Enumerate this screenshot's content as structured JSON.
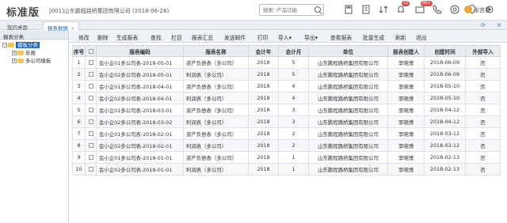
{
  "app": {
    "logo": "标准版",
    "company": "[001]山东鹏程路桥集团有限公司   (2018-06-28)",
    "search_placeholder": "搜索: 产品功能",
    "badges": {
      "messages": "22",
      "alerts": "99+"
    },
    "user_name": "张言置"
  },
  "tabs": [
    {
      "label": "我的桌面"
    },
    {
      "label": "报表数据"
    }
  ],
  "sidebar": {
    "header": "报表分类",
    "root": "模板分类",
    "children": [
      "年报",
      "多公司模板"
    ]
  },
  "toolbar": [
    "修改",
    "删除",
    "生成报表",
    "查找",
    "栏目",
    "报表汇总",
    "发送邮件",
    "打印",
    "导入",
    "导出",
    "查看报表",
    "批量生成",
    "刷新",
    "退出"
  ],
  "table": {
    "headers": [
      "序号",
      "",
      "报表编码",
      "报表名称",
      "会计年",
      "会计月",
      "单位",
      "报表创建人",
      "创建时间",
      "外部导入"
    ],
    "rows": [
      [
        "1",
        "",
        "会小企01多公司表-2018-05-01",
        "资产负债表（多公司）",
        "2018",
        "5",
        "山东鹏程路桥集团有限公司",
        "李晓博",
        "2018-06-09",
        "否"
      ],
      [
        "2",
        "",
        "会小企02多公司表-2018-05-01",
        "利润表（多公司）",
        "2018",
        "5",
        "山东鹏程路桥集团有限公司",
        "李晓博",
        "2018-06-09",
        "否"
      ],
      [
        "3",
        "",
        "会小企01多公司表-2018-04-01",
        "资产负债表（多公司）",
        "2018",
        "4",
        "山东鹏程路桥集团有限公司",
        "李晓博",
        "2018-05-10",
        "否"
      ],
      [
        "4",
        "",
        "会小企02多公司表-2018-04-01",
        "利润表（多公司）",
        "2018",
        "4",
        "山东鹏程路桥集团有限公司",
        "李晓博",
        "2018-05-10",
        "否"
      ],
      [
        "5",
        "",
        "会小企01多公司表-2018-03-01",
        "资产负债表（多公司）",
        "2018",
        "3",
        "山东鹏程路桥集团有限公司",
        "李晓博",
        "2018-04-12",
        "否"
      ],
      [
        "6",
        "",
        "会小企02多公司表-2018-03-02",
        "利润表（多公司）",
        "2018",
        "3",
        "山东鹏程路桥集团有限公司",
        "李晓博",
        "2018-04-12",
        "否"
      ],
      [
        "7",
        "",
        "会小企01多公司表-2018-02-01",
        "资产负债表（多公司）",
        "2018",
        "2",
        "山东鹏程路桥集团有限公司",
        "李晓博",
        "2018-03-12",
        "否"
      ],
      [
        "8",
        "",
        "会小企02多公司表-2018-02-01",
        "利润表（多公司）",
        "2018",
        "2",
        "山东鹏程路桥集团有限公司",
        "李晓博",
        "2018-03-12",
        "否"
      ],
      [
        "9",
        "",
        "会小企01多公司表-2018-01-01",
        "资产负债表（多公司）",
        "2018",
        "1",
        "山东鹏程路桥集团有限公司",
        "李晓博",
        "2018-02-13",
        "否"
      ],
      [
        "10",
        "",
        "会小企02多公司表-2018-01-01",
        "利润表（多公司）",
        "2018",
        "1",
        "山东鹏程路桥集团有限公司",
        "李晓博",
        "2018-02-13",
        "否"
      ]
    ]
  },
  "colors": {
    "accent": "#1d64b5",
    "badge": "#e34a4a"
  }
}
